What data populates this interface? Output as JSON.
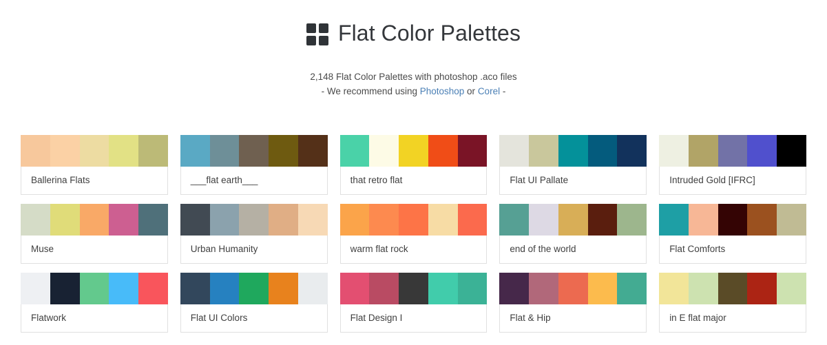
{
  "header": {
    "logo_icon": "grid-squares-icon",
    "title": "Flat Color Palettes",
    "subtitle_line1": "2,148 Flat Color Palettes with photoshop .aco files",
    "reco_prefix": "- We recommend using ",
    "link_photoshop": "Photoshop",
    "reco_middle": "  or ",
    "link_corel": "Corel",
    "reco_suffix": " -",
    "link_color": "#4a7fb5"
  },
  "palettes": [
    {
      "name": "Ballerina Flats",
      "colors": [
        "#f7c89c",
        "#fbd1a5",
        "#eddca2",
        "#e2e185",
        "#bcba77"
      ]
    },
    {
      "name": "___flat earth___",
      "colors": [
        "#5aa9c4",
        "#6e8f98",
        "#6f6050",
        "#6e5a10",
        "#543018"
      ]
    },
    {
      "name": "that retro flat",
      "colors": [
        "#4ad2a8",
        "#fdfbe6",
        "#f2d324",
        "#f04d17",
        "#7a1426"
      ]
    },
    {
      "name": "Flat UI Pallate",
      "colors": [
        "#e4e4dc",
        "#c9c79c",
        "#04919a",
        "#045b7d",
        "#12325c"
      ]
    },
    {
      "name": "Intruded Gold [IFRC]",
      "colors": [
        "#eef0e2",
        "#b1a467",
        "#7272a7",
        "#5050cd",
        "#000000"
      ]
    },
    {
      "name": "Muse",
      "colors": [
        "#d5dcc7",
        "#e0dc79",
        "#f9a967",
        "#cd5f91",
        "#4f707a"
      ]
    },
    {
      "name": "Urban Humanity",
      "colors": [
        "#414a53",
        "#8ba2ad",
        "#b5b0a4",
        "#e0ae85",
        "#f7d9b5"
      ]
    },
    {
      "name": "warm flat rock",
      "colors": [
        "#fba44a",
        "#fd8a4f",
        "#fd7447",
        "#f7dca5",
        "#fb6a4d"
      ]
    },
    {
      "name": "end of the world",
      "colors": [
        "#56a094",
        "#ddd9e4",
        "#d8ae57",
        "#5a1e0e",
        "#9db68d"
      ]
    },
    {
      "name": "Flat Comforts",
      "colors": [
        "#1e9fa5",
        "#f7b796",
        "#340404",
        "#9b511f",
        "#c0bb94"
      ]
    },
    {
      "name": "Flatwork",
      "colors": [
        "#eef0f3",
        "#182233",
        "#63c98d",
        "#48bbf9",
        "#f9555c"
      ]
    },
    {
      "name": "Flat UI Colors",
      "colors": [
        "#32475c",
        "#2681c0",
        "#1fa85d",
        "#e8821d",
        "#e9ecee"
      ]
    },
    {
      "name": "Flat Design I",
      "colors": [
        "#e34f71",
        "#b94b63",
        "#383838",
        "#41ccab",
        "#3bb296"
      ]
    },
    {
      "name": "Flat & Hip",
      "colors": [
        "#46284a",
        "#b1687a",
        "#ec6a50",
        "#fcbb4d",
        "#43ab92"
      ]
    },
    {
      "name": "in E flat major",
      "colors": [
        "#f2e599",
        "#cde2b0",
        "#5a4b27",
        "#ac2414",
        "#cde2b0"
      ]
    }
  ]
}
